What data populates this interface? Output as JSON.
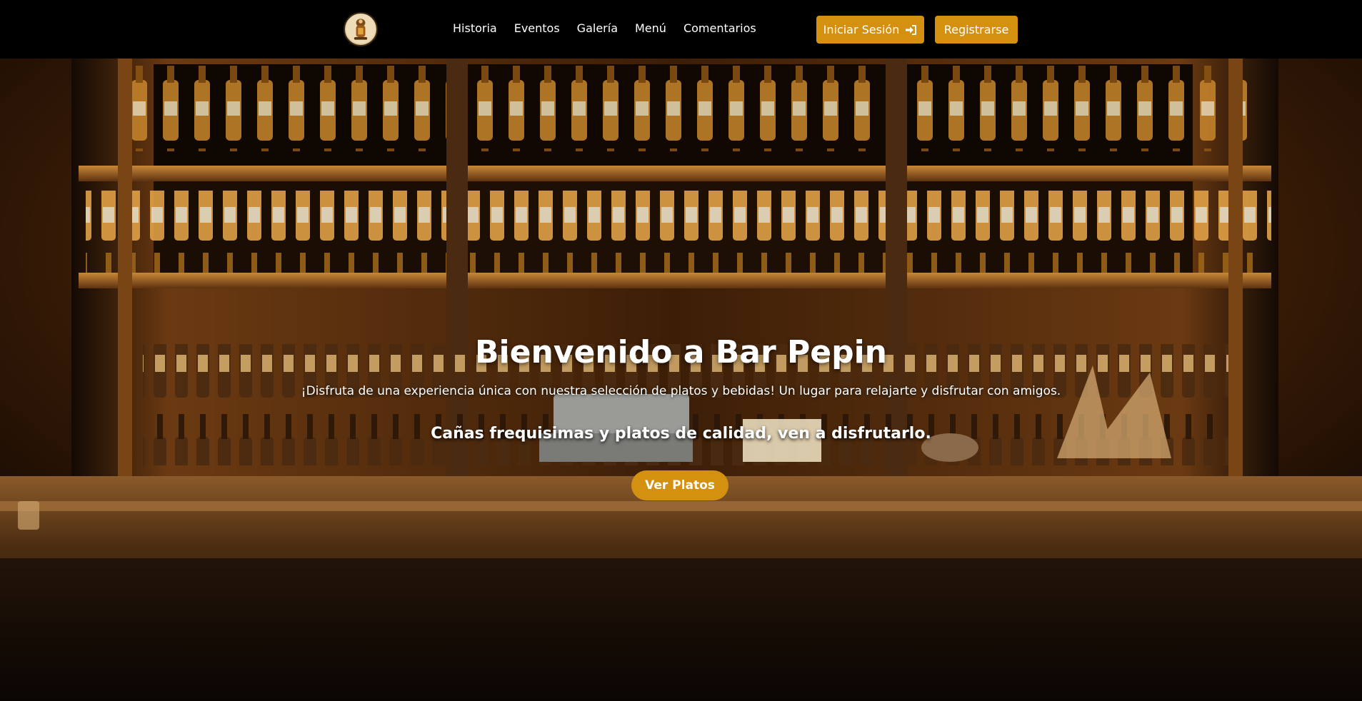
{
  "nav": {
    "logo_alt": "Bar Pepin logo",
    "links": [
      "Historia",
      "Eventos",
      "Galería",
      "Menú",
      "Comentarios"
    ],
    "login_label": "Iniciar Sesión",
    "login_icon": "sign-in-icon",
    "register_label": "Registrarse"
  },
  "hero": {
    "title": "Bienvenido a Bar Pepin",
    "subtitle": "¡Disfruta de una experiencia única con nuestra selección de platos y bebidas! Un lugar para relajarte y disfrutar con amigos.",
    "tagline": "Cañas frequisimas y platos de calidad, ven a disfrutarlo.",
    "cta_label": "Ver Platos",
    "background": "bar-shelves-with-bottles"
  },
  "colors": {
    "accent": "#d4900f",
    "navbar": "#000000",
    "text": "#ffffff"
  }
}
